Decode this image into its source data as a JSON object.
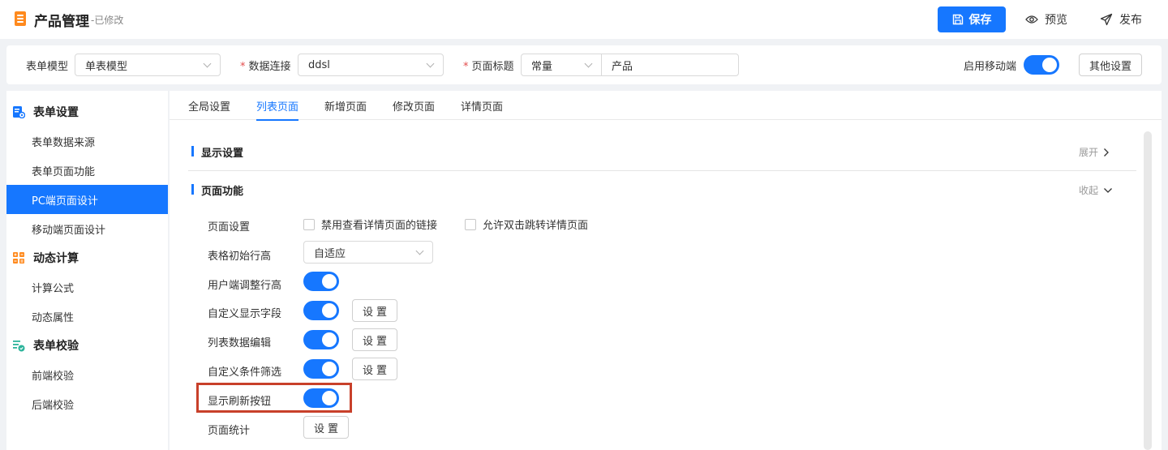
{
  "header": {
    "title": "产品管理",
    "subtitle": "-已修改",
    "save_label": "保存",
    "preview_label": "预览",
    "publish_label": "发布"
  },
  "configbar": {
    "form_model_label": "表单模型",
    "form_model_value": "单表模型",
    "data_conn_label": "数据连接",
    "data_conn_value": "ddsl",
    "page_title_label": "页面标题",
    "page_title_type": "常量",
    "page_title_value": "产品",
    "mobile_label": "启用移动端",
    "mobile_enabled": true,
    "other_label": "其他设置",
    "required_mark": "*"
  },
  "sidebar": {
    "groups": [
      {
        "label": "表单设置",
        "icon": "form-settings-icon",
        "items": [
          "表单数据来源",
          "表单页面功能",
          "PC端页面设计",
          "移动端页面设计"
        ]
      },
      {
        "label": "动态计算",
        "icon": "calculator-icon",
        "items": [
          "计算公式",
          "动态属性"
        ]
      },
      {
        "label": "表单校验",
        "icon": "checklist-icon",
        "items": [
          "前端校验",
          "后端校验"
        ]
      }
    ],
    "active_item": "PC端页面设计"
  },
  "tabs": [
    "全局设置",
    "列表页面",
    "新增页面",
    "修改页面",
    "详情页面"
  ],
  "active_tab": "列表页面",
  "sections": {
    "display": {
      "title": "显示设置",
      "toggle": "展开"
    },
    "function": {
      "title": "页面功能",
      "toggle": "收起"
    }
  },
  "rows": {
    "page_settings": {
      "label": "页面设置",
      "checkbox1": "禁用查看详情页面的链接",
      "checkbox2": "允许双击跳转详情页面"
    },
    "row_height": {
      "label": "表格初始行高",
      "value": "自适应"
    },
    "user_adjust": {
      "label": "用户端调整行高",
      "on": true
    },
    "custom_fields": {
      "label": "自定义显示字段",
      "on": true
    },
    "list_edit": {
      "label": "列表数据编辑",
      "on": true
    },
    "custom_filter": {
      "label": "自定义条件筛选",
      "on": true
    },
    "refresh_button": {
      "label": "显示刷新按钮",
      "on": true
    },
    "page_stats": {
      "label": "页面统计"
    },
    "set_label": "设置"
  },
  "colors": {
    "accent": "#1677ff",
    "highlight": "#c8402a",
    "doc_icon": "#ff8a1e"
  }
}
